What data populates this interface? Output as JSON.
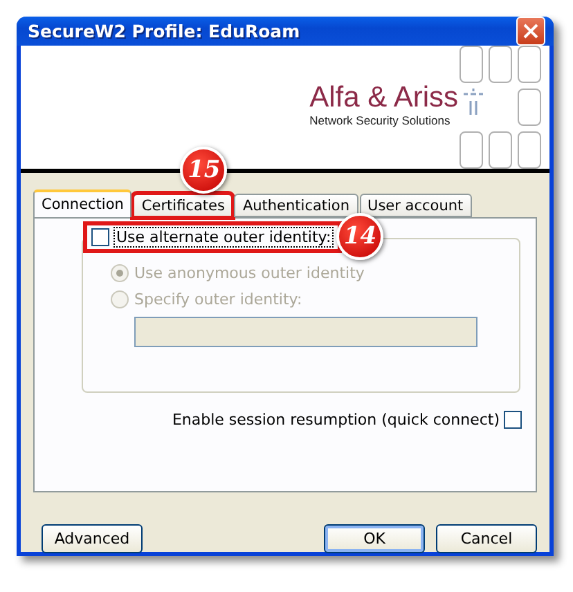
{
  "window": {
    "title": "SecureW2 Profile: EduRoam"
  },
  "banner": {
    "company": "Alfa & Ariss",
    "tagline": "Network Security Solutions"
  },
  "tabs": [
    {
      "label": "Connection",
      "selected": true
    },
    {
      "label": "Certificates",
      "selected": false,
      "callout": "15"
    },
    {
      "label": "Authentication",
      "selected": false
    },
    {
      "label": "User account",
      "selected": false
    }
  ],
  "alternate_identity": {
    "label": "Use alternate outer identity:",
    "checked": false,
    "callout": "14"
  },
  "identity_options": [
    {
      "label": "Use anonymous outer identity",
      "selected": true,
      "disabled": true
    },
    {
      "label": "Specify outer identity:",
      "selected": false,
      "disabled": true
    }
  ],
  "outer_identity_field": {
    "disabled": true
  },
  "session_resumption": {
    "label": "Enable session resumption (quick connect)",
    "checked": false
  },
  "buttons": [
    {
      "label": "Advanced",
      "default": false
    },
    {
      "label": "OK",
      "default": true
    },
    {
      "label": "Cancel",
      "default": false
    }
  ]
}
